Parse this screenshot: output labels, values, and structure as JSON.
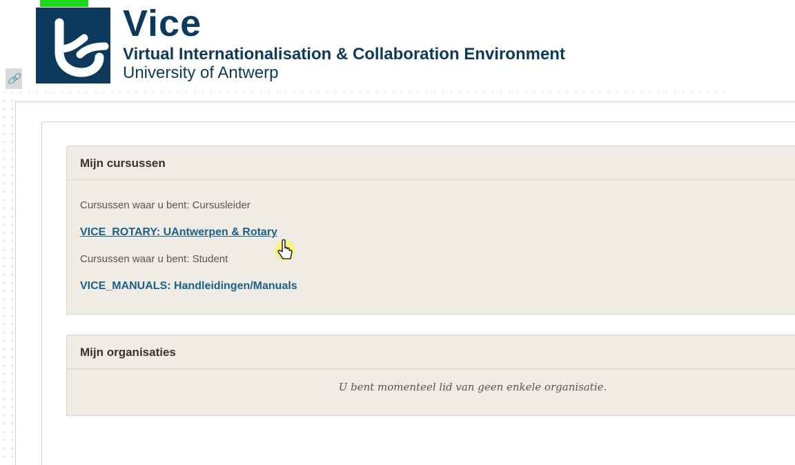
{
  "header": {
    "title": "Vice",
    "subtitle": "Virtual Internationalisation & Collaboration Environment",
    "university": "University of Antwerp"
  },
  "courses": {
    "heading": "Mijn cursussen",
    "groups": [
      {
        "role_label": "Cursussen waar u bent: Cursusleider",
        "course": "VICE_ROTARY: UAntwerpen & Rotary"
      },
      {
        "role_label": "Cursussen waar u bent: Student",
        "course": "VICE_MANUALS: Handleidingen/Manuals"
      }
    ]
  },
  "organisations": {
    "heading": "Mijn organisaties",
    "empty_message": "U bent momenteel lid van geen enkele organisatie."
  },
  "colors": {
    "brand": "#0d3a5c",
    "link": "#1c5f86",
    "panel_bg": "#efece6",
    "marker": "#1dd61d"
  },
  "icons": [
    "university-logo-icon",
    "link-icon",
    "hand-pointer-cursor-icon"
  ]
}
